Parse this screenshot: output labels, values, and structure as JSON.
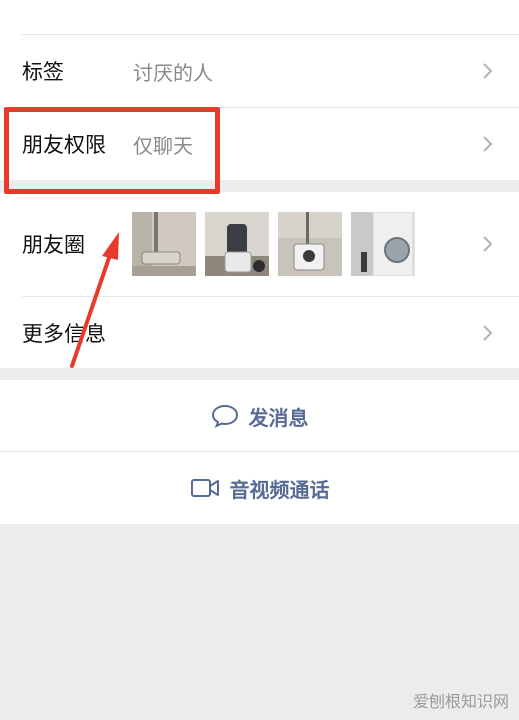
{
  "rows": {
    "tag": {
      "label": "标签",
      "value": "讨厌的人"
    },
    "friend_permission": {
      "label": "朋友权限",
      "value": "仅聊天"
    },
    "moments": {
      "label": "朋友圈"
    },
    "more_info": {
      "label": "更多信息"
    }
  },
  "actions": {
    "send_message": {
      "label": "发消息",
      "icon": "chat-bubble-icon"
    },
    "av_call": {
      "label": "音视频通话",
      "icon": "video-camera-icon"
    }
  },
  "annotation": {
    "box_color": "#e8392c",
    "arrow_color": "#e8392c"
  },
  "colors": {
    "link": "#576b95",
    "background": "#ececec"
  },
  "watermark": "爱刨根知识网"
}
